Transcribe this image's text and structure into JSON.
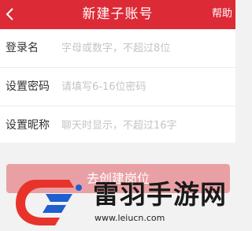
{
  "header": {
    "title": "新建子账号",
    "help_label": "帮助",
    "color": "#dc2a36"
  },
  "form": {
    "username": {
      "label": "登录名",
      "placeholder": "字母或数字，不超过8位",
      "value": ""
    },
    "password": {
      "label": "设置密码",
      "placeholder": "请填写6-16位密码",
      "value": ""
    },
    "nickname": {
      "label": "设置昵称",
      "placeholder": "聊天时显示，不超过16字",
      "value": ""
    }
  },
  "submit": {
    "label": "去创建岗位",
    "color": "#e9a0a4"
  },
  "watermark": {
    "name": "雷羽手游网",
    "url": "www.leiucn.com"
  }
}
